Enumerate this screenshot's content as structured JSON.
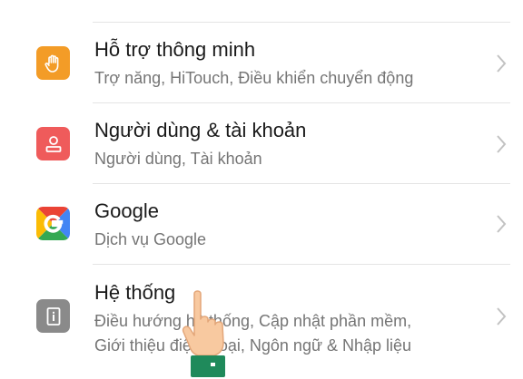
{
  "items": [
    {
      "title": "Hỗ trợ thông minh",
      "subtitle": "Trợ năng, HiTouch, Điều khiển chuyển động",
      "icon": "hand-icon",
      "color": "#f39c27"
    },
    {
      "title": "Người dùng & tài khoản",
      "subtitle": "Người dùng, Tài khoản",
      "icon": "user-icon",
      "color": "#ef5b5b"
    },
    {
      "title": "Google",
      "subtitle": "Dịch vụ Google",
      "icon": "google-icon",
      "color": "#ffffff"
    },
    {
      "title": "Hệ thống",
      "subtitle_line1": "Điều hướng hệ thống, Cập nhật phần mềm,",
      "subtitle_line2": "Giới thiệu điện thoại, Ngôn ngữ & Nhập liệu",
      "icon": "system-info-icon",
      "color": "#8a8a8a"
    }
  ],
  "chevron_icon": "chevron-right-icon",
  "overlay_icon": "pointing-hand-icon"
}
